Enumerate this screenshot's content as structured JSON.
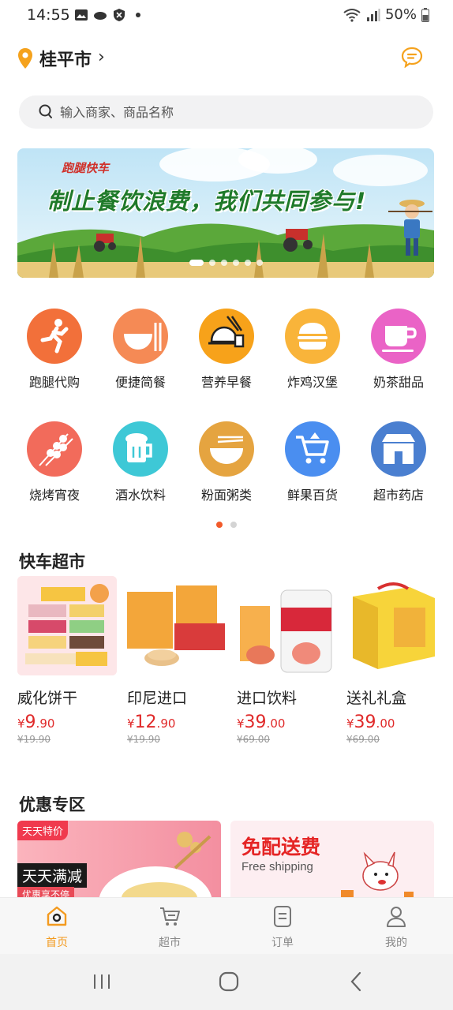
{
  "status_bar": {
    "time": "14:55",
    "battery": "50%"
  },
  "header": {
    "city": "桂平市",
    "chevron": "›"
  },
  "search": {
    "placeholder": "输入商家、商品名称"
  },
  "banner": {
    "logo_text": "跑腿快车",
    "slogan": "制止餐饮浪费，我们共同参与!"
  },
  "categories": [
    {
      "label": "跑腿代购",
      "icon": "running-icon",
      "color": "#f2703a"
    },
    {
      "label": "便捷简餐",
      "icon": "bowl-chopsticks-icon",
      "color": "#f58a55"
    },
    {
      "label": "营养早餐",
      "icon": "steamed-bun-icon",
      "color": "#f7a21a"
    },
    {
      "label": "炸鸡汉堡",
      "icon": "burger-icon",
      "color": "#f9b43a"
    },
    {
      "label": "奶茶甜品",
      "icon": "coffee-cup-icon",
      "color": "#ea63c6"
    },
    {
      "label": "烧烤宵夜",
      "icon": "skewer-icon",
      "color": "#f26b5b"
    },
    {
      "label": "酒水饮料",
      "icon": "beer-mug-icon",
      "color": "#3ec8d6"
    },
    {
      "label": "粉面粥类",
      "icon": "noodle-bowl-icon",
      "color": "#e5a440"
    },
    {
      "label": "鲜果百货",
      "icon": "cart-icon",
      "color": "#4a8ef0"
    },
    {
      "label": "超市药店",
      "icon": "store-icon",
      "color": "#4a7fd0"
    }
  ],
  "sections": {
    "market_title": "快车超市",
    "promo_title": "优惠专区"
  },
  "products": [
    {
      "name": "威化饼干",
      "price_int": "9",
      "price_dec": ".90",
      "old_price": "¥19.90"
    },
    {
      "name": "印尼进口",
      "price_int": "12",
      "price_dec": ".90",
      "old_price": "¥19.90"
    },
    {
      "name": "进口饮料",
      "price_int": "39",
      "price_dec": ".00",
      "old_price": "¥69.00"
    },
    {
      "name": "送礼礼盒",
      "price_int": "39",
      "price_dec": ".00",
      "old_price": "¥69.00"
    }
  ],
  "currency": "¥",
  "promo": {
    "left_tag": "天天特价",
    "left_title": "天天满减",
    "left_sub": "优惠享不停",
    "right_title": "免配送费",
    "right_sub": "Free shipping"
  },
  "tabs": [
    {
      "label": "首页",
      "icon": "home-icon",
      "active": true
    },
    {
      "label": "超市",
      "icon": "cart-icon",
      "active": false
    },
    {
      "label": "订单",
      "icon": "order-list-icon",
      "active": false
    },
    {
      "label": "我的",
      "icon": "user-icon",
      "active": false
    }
  ],
  "colors": {
    "accent": "#f39a1e",
    "price": "#e02a2a"
  }
}
